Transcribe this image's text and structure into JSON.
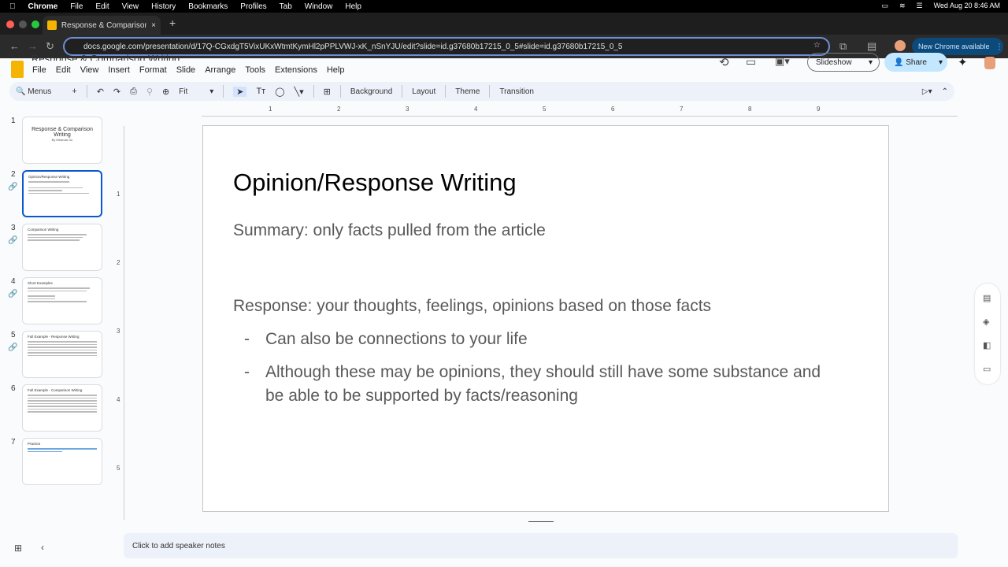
{
  "mac": {
    "menu": [
      "Chrome",
      "File",
      "Edit",
      "View",
      "History",
      "Bookmarks",
      "Profiles",
      "Tab",
      "Window",
      "Help"
    ],
    "clock": "Wed Aug 20  8:46 AM"
  },
  "browser": {
    "tab_title": "Response & Comparison Writing",
    "url": "docs.google.com/presentation/d/17Q-CGxdgT5VixUKxWtmtKymHl2pPPLVWJ-xK_nSnYJU/edit?slide=id.g37680b17215_0_5#slide=id.g37680b17215_0_5",
    "new_chrome": "New Chrome available"
  },
  "doc": {
    "title": "Response & Comparison Writing",
    "menu": [
      "File",
      "Edit",
      "View",
      "Insert",
      "Format",
      "Slide",
      "Arrange",
      "Tools",
      "Extensions",
      "Help"
    ],
    "slideshow": "Slideshow",
    "share": "Share"
  },
  "toolbar": {
    "menus": "Menus",
    "zoom": "Fit",
    "background": "Background",
    "layout": "Layout",
    "theme": "Theme",
    "transition": "Transition"
  },
  "ruler": {
    "h": [
      "1",
      "2",
      "3",
      "4",
      "5",
      "6",
      "7",
      "8",
      "9"
    ],
    "v": [
      "1",
      "2",
      "3",
      "4",
      "5"
    ]
  },
  "thumbs": [
    {
      "n": "1",
      "title": "Response & Comparison Writing",
      "sub": "By Miranda Gu"
    },
    {
      "n": "2",
      "title": "Opinion/Response Writing"
    },
    {
      "n": "3",
      "title": "Comparison Writing"
    },
    {
      "n": "4",
      "title": "Short Examples"
    },
    {
      "n": "5",
      "title": "Full Example - Response Writing"
    },
    {
      "n": "6",
      "title": "Full Example - Comparison Writing"
    },
    {
      "n": "7",
      "title": "Practice"
    }
  ],
  "slide": {
    "title": "Opinion/Response Writing",
    "summary": "Summary: only facts pulled from the article",
    "response": "Response: your thoughts, feelings, opinions based on those facts",
    "bullets": [
      "Can also be connections to your life",
      "Although these may be opinions, they should still have some substance and be able to be supported by facts/reasoning"
    ],
    "dash": "-"
  },
  "notes": "Click to add speaker notes"
}
